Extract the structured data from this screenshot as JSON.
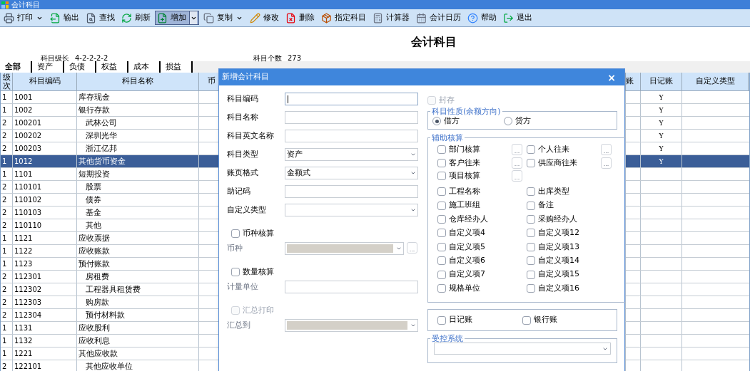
{
  "window": {
    "title": "会计科目"
  },
  "toolbar": [
    {
      "label": "打印",
      "dropdown": true,
      "pressed": false
    },
    {
      "label": "输出",
      "dropdown": false,
      "pressed": false
    },
    {
      "label": "查找",
      "dropdown": false,
      "pressed": false
    },
    {
      "label": "刷新",
      "dropdown": false,
      "pressed": false
    },
    {
      "label": "增加",
      "dropdown": true,
      "pressed": true
    },
    {
      "label": "复制",
      "dropdown": true,
      "pressed": false
    },
    {
      "label": "修改",
      "dropdown": false,
      "pressed": false
    },
    {
      "label": "删除",
      "dropdown": false,
      "pressed": false
    },
    {
      "label": "指定科目",
      "dropdown": false,
      "pressed": false
    },
    {
      "label": "计算器",
      "dropdown": false,
      "pressed": false
    },
    {
      "label": "会计日历",
      "dropdown": false,
      "pressed": false
    },
    {
      "label": "帮助",
      "dropdown": false,
      "pressed": false
    },
    {
      "label": "退出",
      "dropdown": false,
      "pressed": false
    }
  ],
  "page_title": "会计科目",
  "info": [
    {
      "label": "科目级长",
      "value": "4-2-2-2-2"
    },
    {
      "label": "科目个数",
      "value": "273"
    }
  ],
  "tabs": [
    {
      "label": "全部",
      "selected": true
    },
    {
      "label": "资产",
      "selected": false
    },
    {
      "label": "负债",
      "selected": false
    },
    {
      "label": "权益",
      "selected": false
    },
    {
      "label": "成本",
      "selected": false
    },
    {
      "label": "损益",
      "selected": false
    }
  ],
  "table": {
    "columns": [
      "级次",
      "科目编码",
      "科目名称",
      "币",
      "账",
      "日记账",
      "自定义类型"
    ],
    "rows": [
      {
        "level": "1",
        "code": "1001",
        "name": "库存现金",
        "journal": "Y",
        "selected": false
      },
      {
        "level": "1",
        "code": "1002",
        "name": "银行存款",
        "journal": "Y",
        "selected": false,
        "children": [
          {
            "level": "2",
            "code": "100201",
            "name": "武林公司",
            "journal": "Y",
            "selected": false
          },
          {
            "level": "2",
            "code": "100202",
            "name": "深圳光华",
            "journal": "Y",
            "selected": false
          },
          {
            "level": "2",
            "code": "100203",
            "name": "浙江亿邦",
            "journal": "Y",
            "selected": false
          }
        ]
      },
      {
        "level": "1",
        "code": "1012",
        "name": "其他货币资金",
        "journal": "Y",
        "selected": true
      },
      {
        "level": "1",
        "code": "1101",
        "name": "短期投资",
        "selected": false,
        "children": [
          {
            "level": "2",
            "code": "110101",
            "name": "股票",
            "selected": false
          },
          {
            "level": "2",
            "code": "110102",
            "name": "债券",
            "selected": false
          },
          {
            "level": "2",
            "code": "110103",
            "name": "基金",
            "selected": false
          },
          {
            "level": "2",
            "code": "110110",
            "name": "其他",
            "selected": false
          }
        ]
      },
      {
        "level": "1",
        "code": "1121",
        "name": "应收票据",
        "selected": false
      },
      {
        "level": "1",
        "code": "1122",
        "name": "应收账款",
        "selected": false
      },
      {
        "level": "1",
        "code": "1123",
        "name": "预付账款",
        "selected": false,
        "children": [
          {
            "level": "2",
            "code": "112301",
            "name": "房租费",
            "selected": false
          },
          {
            "level": "2",
            "code": "112302",
            "name": "工程器具租赁费",
            "selected": false
          },
          {
            "level": "2",
            "code": "112303",
            "name": "购房款",
            "selected": false
          },
          {
            "level": "2",
            "code": "112304",
            "name": "预付材料款",
            "selected": false
          }
        ]
      },
      {
        "level": "1",
        "code": "1131",
        "name": "应收股利",
        "selected": false
      },
      {
        "level": "1",
        "code": "1132",
        "name": "应收利息",
        "selected": false
      },
      {
        "level": "1",
        "code": "1221",
        "name": "其他应收款",
        "selected": false,
        "children": [
          {
            "level": "2",
            "code": "122101",
            "name": "其他应收单位",
            "selected": false
          }
        ]
      }
    ]
  },
  "dialog": {
    "title": "新增会计科目",
    "close": "×",
    "fields": [
      {
        "kind": "text",
        "label": "科目编码",
        "focused": true,
        "disabled": false
      },
      {
        "kind": "text",
        "label": "科目名称",
        "focused": false,
        "disabled": false
      },
      {
        "kind": "text",
        "label": "科目英文名称",
        "focused": false,
        "disabled": false
      },
      {
        "kind": "select",
        "label": "科目类型",
        "value": "资产",
        "disabled": false
      },
      {
        "kind": "select",
        "label": "账页格式",
        "value": "金额式",
        "disabled": false
      },
      {
        "kind": "text",
        "label": "助记码",
        "focused": false,
        "disabled": false
      },
      {
        "kind": "select",
        "label": "自定义类型",
        "disabled": false
      },
      {
        "kind": "check",
        "label": "币种核算",
        "checked": false,
        "disabled": false
      },
      {
        "kind": "select",
        "label": "币种",
        "disabled": true,
        "browse": "..."
      },
      {
        "kind": "check",
        "label": "数量核算",
        "checked": false,
        "disabled": false
      },
      {
        "kind": "text",
        "label": "计量单位",
        "focused": false,
        "disabled": true
      },
      {
        "kind": "check",
        "label": "汇总打印",
        "checked": false,
        "disabled": true
      },
      {
        "kind": "select",
        "label": "汇总到",
        "disabled": true
      }
    ],
    "archive": {
      "label": "封存",
      "checked": false
    },
    "direction": {
      "legend": "科目性质(余额方向)",
      "options": [
        {
          "label": "借方",
          "selected": true
        },
        {
          "label": "贷方",
          "selected": false
        }
      ]
    },
    "auxiliary": {
      "legend": "辅助核算",
      "rows": [
        {
          "left": {
            "label": "部门核算",
            "checked": false,
            "browse": "..."
          },
          "right": {
            "label": "个人往来",
            "checked": false,
            "browse": "..."
          }
        },
        {
          "left": {
            "label": "客户往来",
            "checked": false,
            "browse": "..."
          },
          "right": {
            "label": "供应商往来",
            "checked": false,
            "browse": "..."
          }
        },
        {
          "left": {
            "label": "项目核算",
            "checked": false,
            "browse": "..."
          }
        },
        {
          "left": {
            "label": "工程名称",
            "checked": false
          },
          "right": {
            "label": "出库类型",
            "checked": false
          }
        },
        {
          "left": {
            "label": "施工班组",
            "checked": false
          },
          "right": {
            "label": "备注",
            "checked": false
          }
        },
        {
          "left": {
            "label": "仓库经办人",
            "checked": false
          },
          "right": {
            "label": "采购经办人",
            "checked": false
          }
        },
        {
          "left": {
            "label": "自定义项4",
            "checked": false
          },
          "right": {
            "label": "自定义项12",
            "checked": false
          }
        },
        {
          "left": {
            "label": "自定义项5",
            "checked": false
          },
          "right": {
            "label": "自定义项13",
            "checked": false
          }
        },
        {
          "left": {
            "label": "自定义项6",
            "checked": false
          },
          "right": {
            "label": "自定义项14",
            "checked": false
          }
        },
        {
          "left": {
            "label": "自定义项7",
            "checked": false
          },
          "right": {
            "label": "自定义项15",
            "checked": false
          }
        },
        {
          "left": {
            "label": "规格单位",
            "checked": false
          },
          "right": {
            "label": "自定义项16",
            "checked": false
          }
        }
      ]
    },
    "ledgers": [
      {
        "label": "日记账",
        "checked": false
      },
      {
        "label": "银行账",
        "checked": false
      }
    ],
    "controlled": {
      "legend": "受控系统"
    }
  }
}
